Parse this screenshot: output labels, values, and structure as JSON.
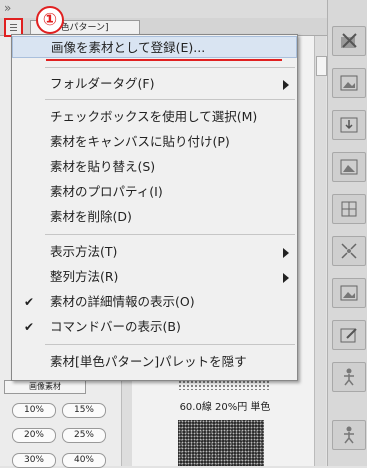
{
  "tab": {
    "label": "材[単色パターン]"
  },
  "annotation": {
    "badge": "①",
    "accent": "#e02020"
  },
  "menu": {
    "items": [
      {
        "label": "画像を素材として登録(E)...",
        "highlighted": true
      },
      {
        "label": "フォルダータグ(F)",
        "submenu": true
      },
      {
        "label": "チェックボックスを使用して選択(M)"
      },
      {
        "label": "素材をキャンバスに貼り付け(P)"
      },
      {
        "label": "素材を貼り替え(S)"
      },
      {
        "label": "素材のプロパティ(I)"
      },
      {
        "label": "素材を削除(D)"
      },
      {
        "label": "表示方法(T)",
        "submenu": true
      },
      {
        "label": "整列方法(R)",
        "submenu": true
      },
      {
        "label": "素材の詳細情報の表示(O)",
        "checked": true
      },
      {
        "label": "コマンドバーの表示(B)",
        "checked": true
      },
      {
        "label": "素材[単色パターン]パレットを隠す"
      }
    ]
  },
  "left": {
    "header": "画像素材",
    "pills": [
      "10%",
      "15%",
      "20%",
      "25%",
      "30%",
      "40%"
    ]
  },
  "preview": {
    "caption": "60.0線 20%円 単色"
  },
  "toolbar": {
    "icons": [
      "close-x-icon",
      "image-icon",
      "image-download-icon",
      "image-icon",
      "grid-icon",
      "scatter-icon",
      "image-icon",
      "edit-icon",
      "figure-icon",
      "figure-icon"
    ]
  }
}
